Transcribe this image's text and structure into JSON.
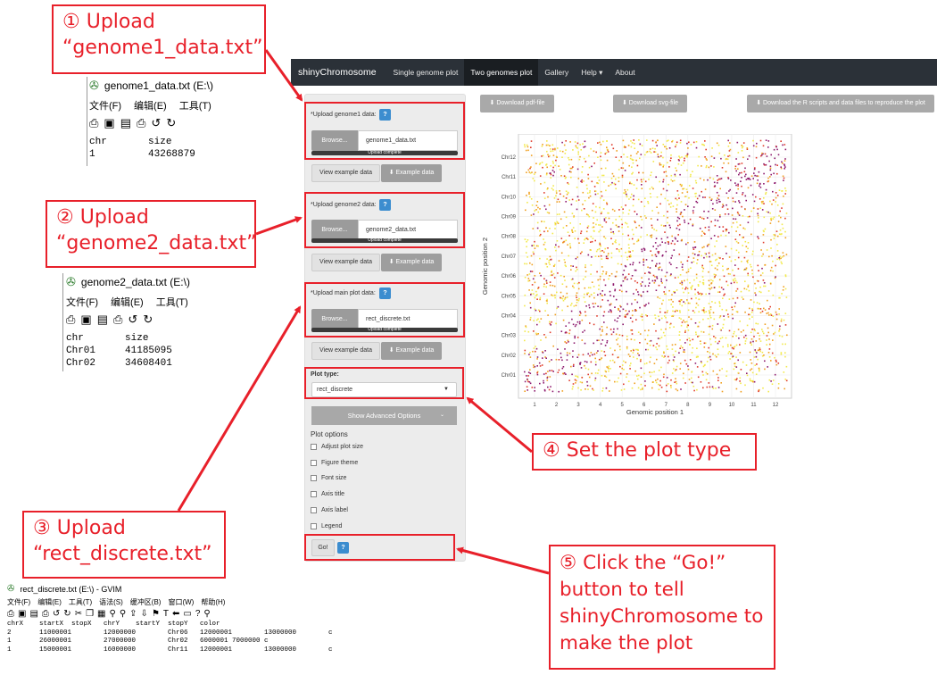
{
  "callouts": {
    "c1": {
      "num": "①",
      "line1": "Upload",
      "line2": "“genome1_data.txt”"
    },
    "c2": {
      "num": "②",
      "line1": "Upload",
      "line2": "“genome2_data.txt”"
    },
    "c3": {
      "num": "③",
      "line1": "Upload",
      "line2": "“rect_discrete.txt”"
    },
    "c4": {
      "num": "④",
      "text": "Set the plot type"
    },
    "c5": {
      "num": "⑤",
      "lines": [
        "Click the “Go!”",
        "button to tell",
        "shinyChromosome to",
        "make the plot"
      ]
    }
  },
  "editors": {
    "g1": {
      "title": "genome1_data.txt (E:\\)",
      "menu": [
        "文件(F)",
        "编辑(E)",
        "工具(T)"
      ],
      "lines": [
        "chr       size",
        "1         43268879"
      ]
    },
    "g2": {
      "title": "genome2_data.txt (E:\\)",
      "menu": [
        "文件(F)",
        "编辑(E)",
        "工具(T)"
      ],
      "lines": [
        "chr       size",
        "Chr01     41185095",
        "Chr02     34608401"
      ]
    },
    "rd": {
      "title": "rect_discrete.txt (E:\\) - GVIM",
      "menu": [
        "文件(F)",
        "编辑(E)",
        "工具(T)",
        "语法(S)",
        "缓冲区(B)",
        "窗口(W)",
        "帮助(H)"
      ],
      "lines": [
        "chrX    startX  stopX   chrY    startY  stopY   color",
        "2       11000001        12000000        Chr06   12000001        13000000        c",
        "1       26000001        27000000        Chr02   6000001 7000000 c",
        "1       15000001        16000000        Chr11   12000001        13000000        c"
      ]
    }
  },
  "app": {
    "brand": "shinyChromosome",
    "nav": [
      "Single genome plot",
      "Two genomes plot",
      "Gallery",
      "Help ▾",
      "About"
    ],
    "upload1_label": "*Upload genome1 data:",
    "upload2_label": "*Upload genome2 data:",
    "upload3_label": "*Upload main plot data:",
    "browse": "Browse...",
    "file1": "genome1_data.txt",
    "file2": "genome2_data.txt",
    "file3": "rect_discrete.txt",
    "upload_complete": "Upload complete",
    "help_q": "?",
    "view_example": "View example data",
    "example_data": "⬇ Example data",
    "plot_type_label": "Plot type:",
    "plot_type_value": "rect_discrete",
    "advanced": "Show Advanced Options",
    "plot_options_label": "Plot options",
    "plot_options": [
      "Adjust plot size",
      "Figure theme",
      "Font size",
      "Axis title",
      "Axis label",
      "Legend"
    ],
    "go": "Go!",
    "downloads": [
      "⬇ Download pdf-file",
      "⬇ Download svg-file",
      "⬇ Download the R scripts and data files to reproduce the plot"
    ]
  },
  "chart_data": {
    "type": "scatter",
    "xlabel": "Genomic position 1",
    "ylabel": "Genomic position 2",
    "x_ticks": [
      "1",
      "2",
      "3",
      "4",
      "5",
      "6",
      "7",
      "8",
      "9",
      "10",
      "11",
      "12"
    ],
    "y_ticks": [
      "Chr01",
      "Chr02",
      "Chr03",
      "Chr04",
      "Chr05",
      "Chr06",
      "Chr07",
      "Chr08",
      "Chr09",
      "Chr10",
      "Chr11",
      "Chr12"
    ],
    "colors": [
      "#f2e94a",
      "#f0a020",
      "#e03a2a",
      "#8e1a6e"
    ],
    "grid": true
  }
}
